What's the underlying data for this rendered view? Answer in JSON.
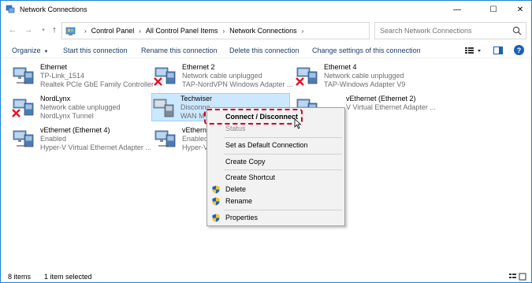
{
  "window": {
    "title": "Network Connections",
    "controls": {
      "minimize": "—",
      "maximize": "☐",
      "close": "✕"
    }
  },
  "address": {
    "breadcrumbs": [
      "Control Panel",
      "All Control Panel Items",
      "Network Connections"
    ],
    "search_placeholder": "Search Network Connections"
  },
  "toolbar": {
    "organize": "Organize",
    "start": "Start this connection",
    "rename": "Rename this connection",
    "delete": "Delete this connection",
    "change": "Change settings of this connection"
  },
  "connections": [
    {
      "name": "Ethernet",
      "status": "TP-Link_1514",
      "adapter": "Realtek PCIe GbE Family Controller",
      "disconnected": false
    },
    {
      "name": "Ethernet 2",
      "status": "Network cable unplugged",
      "adapter": "TAP-NordVPN Windows Adapter ...",
      "disconnected": true
    },
    {
      "name": "Ethernet 4",
      "status": "Network cable unplugged",
      "adapter": "TAP-Windows Adapter V9",
      "disconnected": true
    },
    {
      "name": "NordLynx",
      "status": "Network cable unplugged",
      "adapter": "NordLynx Tunnel",
      "disconnected": true
    },
    {
      "name": "Techwiser",
      "status": "Disconne",
      "adapter": "WAN M",
      "disconnected": false,
      "selected": true
    },
    {
      "name": "vEthernet (Ethernet 2)",
      "status": "",
      "adapter": "V Virtual Ethernet Adapter ...",
      "disconnected": true
    },
    {
      "name": "vEthernet (Ethernet 4)",
      "status": "Enabled",
      "adapter": "Hyper-V Virtual Ethernet Adapter ...",
      "disconnected": false
    },
    {
      "name": "vEthern",
      "status": "Enabled",
      "adapter": "Hyper-V",
      "disconnected": false
    }
  ],
  "context_menu": {
    "items": [
      {
        "label": "Connect / Disconnect",
        "bold": true,
        "disabled": false,
        "shield": false
      },
      {
        "label": "Status",
        "bold": false,
        "disabled": true,
        "shield": false
      },
      {
        "label": "Set as Default Connection",
        "bold": false,
        "disabled": false,
        "shield": false
      },
      {
        "label": "Create Copy",
        "bold": false,
        "disabled": false,
        "shield": false
      },
      {
        "label": "Create Shortcut",
        "bold": false,
        "disabled": false,
        "shield": false
      },
      {
        "label": "Delete",
        "bold": false,
        "disabled": false,
        "shield": true
      },
      {
        "label": "Rename",
        "bold": false,
        "disabled": false,
        "shield": true
      },
      {
        "label": "Properties",
        "bold": false,
        "disabled": false,
        "shield": true
      }
    ]
  },
  "statusbar": {
    "item_count": "8 items",
    "selected_count": "1 item selected"
  },
  "colors": {
    "accent": "#1883d7",
    "selection_bg": "#cce8ff",
    "highlight_border": "#d0021b",
    "disconnect_x": "#e81123"
  }
}
